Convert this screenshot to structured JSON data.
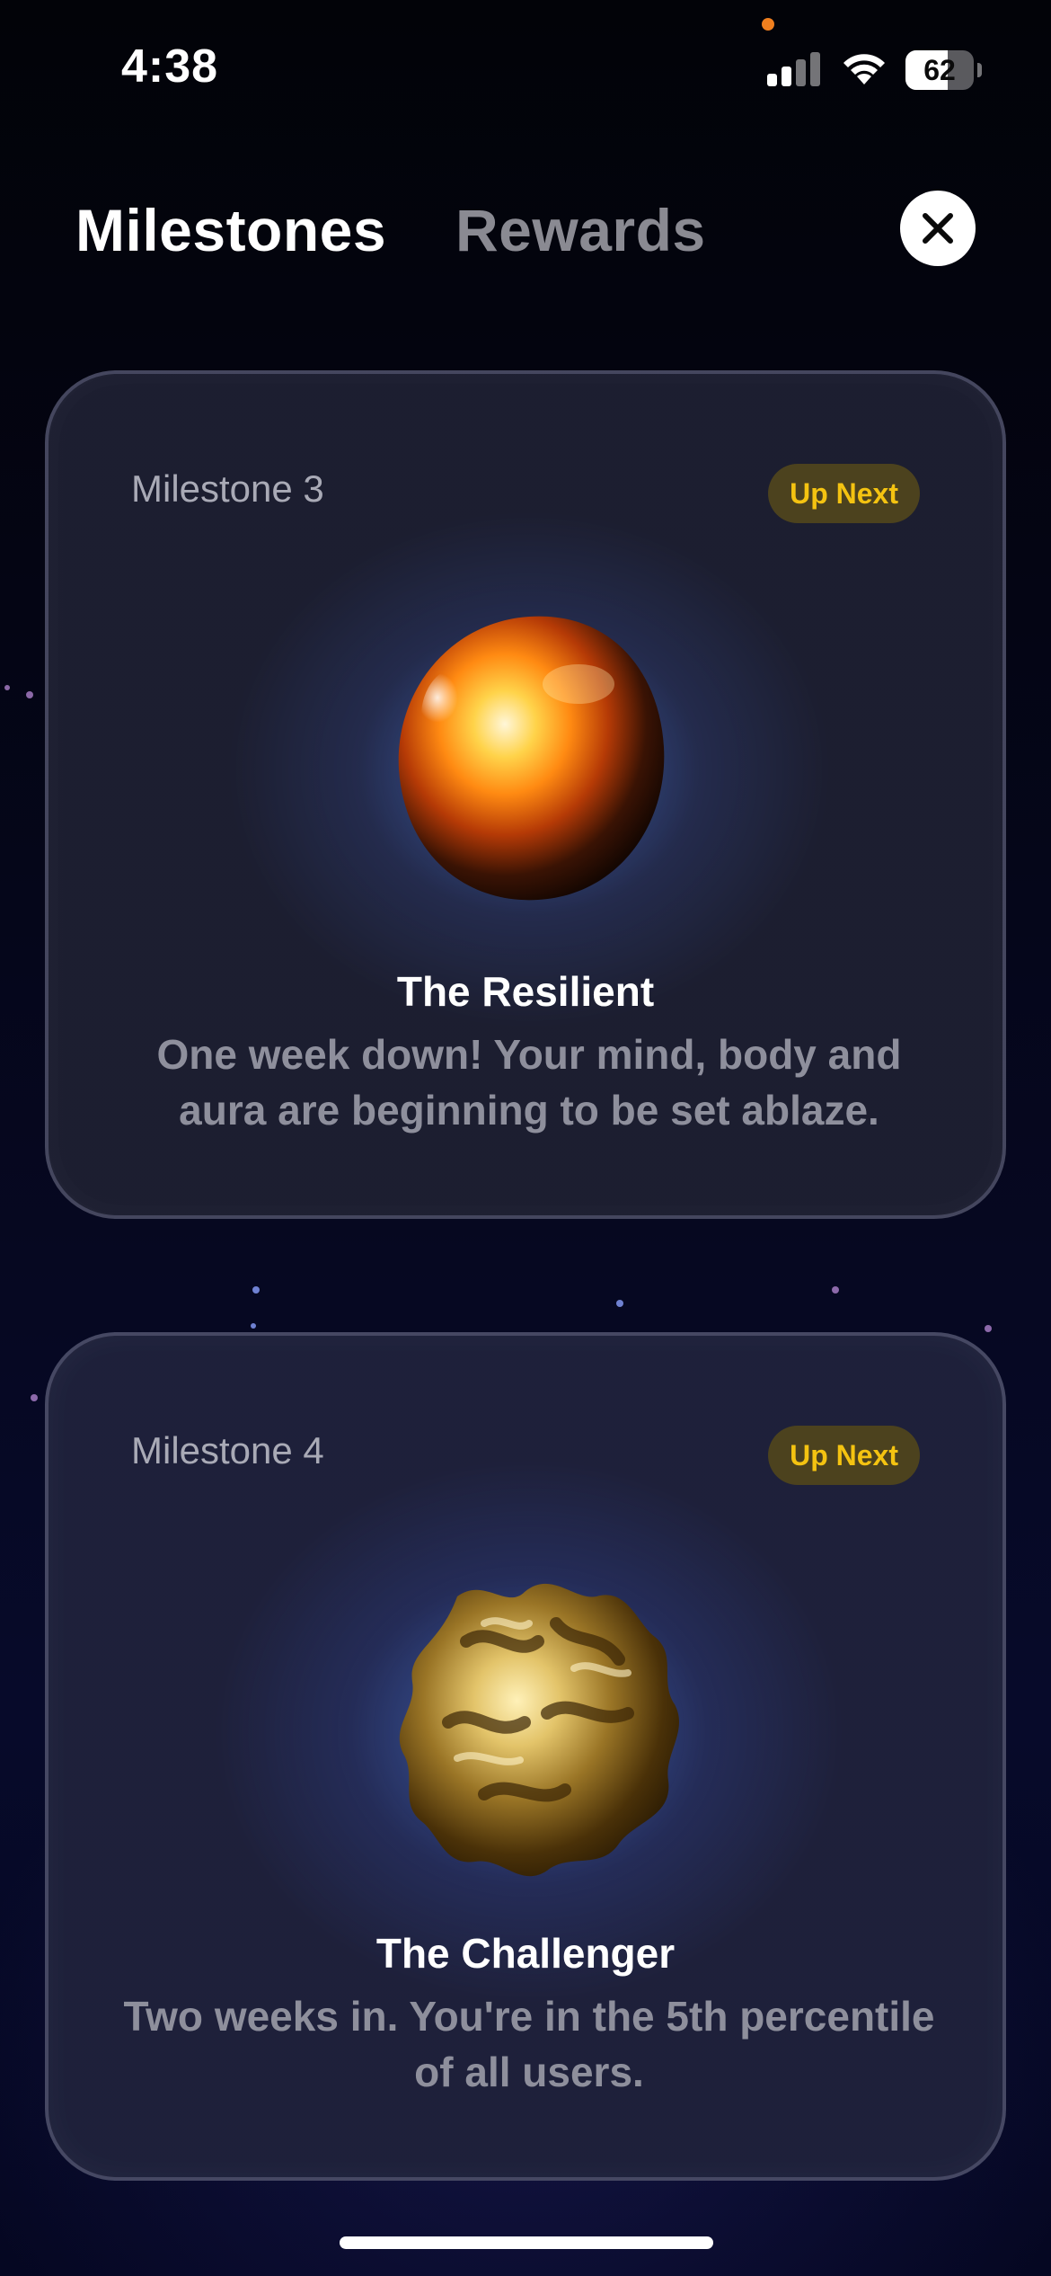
{
  "status_bar": {
    "time": "4:38",
    "battery_percent": 62,
    "battery_label": "62",
    "icons": [
      "signal-icon",
      "wifi-icon",
      "battery-icon"
    ]
  },
  "header": {
    "tabs": [
      {
        "label": "Milestones",
        "active": true
      },
      {
        "label": "Rewards",
        "active": false
      }
    ],
    "close_icon": "close-icon"
  },
  "milestones": [
    {
      "label": "Milestone 3",
      "badge": "Up Next",
      "title": "The Resilient",
      "description": "One week down! Your mind, body and aura are beginning to be set ablaze.",
      "image": "glowing-orb"
    },
    {
      "label": "Milestone 4",
      "badge": "Up Next",
      "title": "The Challenger",
      "description": "Two weeks in. You're in the 5th percentile of all users.",
      "image": "golden-rock"
    }
  ],
  "colors": {
    "badge_text": "#f4c311",
    "badge_bg": "#4c421e",
    "active_tab": "#ffffff",
    "inactive_tab": "#8a8a92",
    "description_text": "#8e8f9c"
  }
}
